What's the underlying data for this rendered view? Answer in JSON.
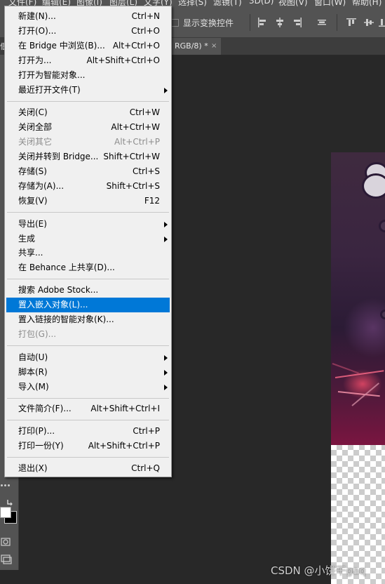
{
  "menubar": {
    "items": [
      "文件(F)",
      "编辑(E)",
      "图像(I)",
      "图层(L)",
      "文字(Y)",
      "选择(S)",
      "滤镜(T)",
      "3D(D)",
      "视图(V)",
      "窗口(W)",
      "帮助(H)"
    ]
  },
  "optionsbar": {
    "show_transform_controls": "显示变换控件"
  },
  "document_tab": {
    "title": "RGB/8) *",
    "close": "×"
  },
  "file_menu": {
    "new": {
      "label": "新建(N)...",
      "shortcut": "Ctrl+N"
    },
    "open": {
      "label": "打开(O)...",
      "shortcut": "Ctrl+O"
    },
    "browse_in_bridge": {
      "label": "在 Bridge 中浏览(B)...",
      "shortcut": "Alt+Ctrl+O"
    },
    "open_as": {
      "label": "打开为...",
      "shortcut": "Alt+Shift+Ctrl+O"
    },
    "open_as_smart_object": {
      "label": "打开为智能对象..."
    },
    "open_recent": {
      "label": "最近打开文件(T)"
    },
    "close": {
      "label": "关闭(C)",
      "shortcut": "Ctrl+W"
    },
    "close_all": {
      "label": "关闭全部",
      "shortcut": "Alt+Ctrl+W"
    },
    "close_others": {
      "label": "关闭其它",
      "shortcut": "Alt+Ctrl+P"
    },
    "close_and_go_to_bridge": {
      "label": "关闭并转到 Bridge...",
      "shortcut": "Shift+Ctrl+W"
    },
    "save": {
      "label": "存储(S)",
      "shortcut": "Ctrl+S"
    },
    "save_as": {
      "label": "存储为(A)...",
      "shortcut": "Shift+Ctrl+S"
    },
    "revert": {
      "label": "恢复(V)",
      "shortcut": "F12"
    },
    "export": {
      "label": "导出(E)"
    },
    "generate": {
      "label": "生成"
    },
    "share": {
      "label": "共享..."
    },
    "share_on_behance": {
      "label": "在 Behance 上共享(D)..."
    },
    "search_adobe_stock": {
      "label": "搜索 Adobe Stock..."
    },
    "place_embedded": {
      "label": "置入嵌入对象(L)..."
    },
    "place_linked": {
      "label": "置入链接的智能对象(K)..."
    },
    "package": {
      "label": "打包(G)..."
    },
    "automate": {
      "label": "自动(U)"
    },
    "scripts": {
      "label": "脚本(R)"
    },
    "import": {
      "label": "导入(M)"
    },
    "file_info": {
      "label": "文件简介(F)...",
      "shortcut": "Alt+Shift+Ctrl+I"
    },
    "print": {
      "label": "打印(P)...",
      "shortcut": "Ctrl+P"
    },
    "print_one_copy": {
      "label": "打印一份(Y)",
      "shortcut": "Alt+Shift+Ctrl+P"
    },
    "exit": {
      "label": "退出(X)",
      "shortcut": "Ctrl+Q"
    }
  },
  "watermark": "CSDN @小饼干gaq",
  "colors": {
    "menu_highlight": "#0078d7",
    "menu_background": "#f0f0f0",
    "disabled_text": "#8d8d8d",
    "app_background": "#282828",
    "panel": "#535353"
  }
}
